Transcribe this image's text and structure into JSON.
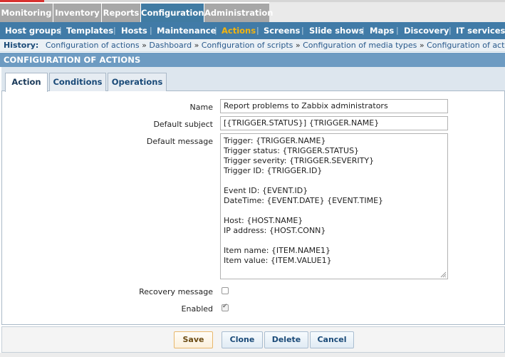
{
  "top_menu": [
    {
      "label": "Monitoring"
    },
    {
      "label": "Inventory"
    },
    {
      "label": "Reports"
    },
    {
      "label": "Configuration"
    },
    {
      "label": "Administration"
    }
  ],
  "sub_menu": [
    {
      "label": "Host groups"
    },
    {
      "label": "Templates"
    },
    {
      "label": "Hosts"
    },
    {
      "label": "Maintenance"
    },
    {
      "label": "Actions"
    },
    {
      "label": "Screens"
    },
    {
      "label": "Slide shows"
    },
    {
      "label": "Maps"
    },
    {
      "label": "Discovery"
    },
    {
      "label": "IT services"
    }
  ],
  "sub_menu_separator": "|",
  "history": {
    "label": "History:",
    "separator": "»",
    "items": [
      "Configuration of actions",
      "Dashboard",
      "Configuration of scripts",
      "Configuration of media types",
      "Configuration of actions"
    ]
  },
  "page_title": "CONFIGURATION OF ACTIONS",
  "tabs": [
    {
      "label": "Action"
    },
    {
      "label": "Conditions"
    },
    {
      "label": "Operations"
    }
  ],
  "form": {
    "name_label": "Name",
    "name_value": "Report problems to Zabbix administrators",
    "subject_label": "Default subject",
    "subject_value": "[{TRIGGER.STATUS}] {TRIGGER.NAME}",
    "message_label": "Default message",
    "message_lines": [
      "Trigger: {TRIGGER.NAME}",
      "Trigger status: {TRIGGER.STATUS}",
      "Trigger severity: {TRIGGER.SEVERITY}",
      "Trigger ID: {TRIGGER.ID}",
      "",
      "Event ID: {EVENT.ID}",
      "DateTime: {EVENT.DATE} {EVENT.TIME}",
      "",
      "Host: {HOST.NAME}",
      "IP address: {HOST.CONN}",
      "",
      "Item name: {ITEM.NAME1}",
      "Item value: {ITEM.VALUE1}"
    ],
    "recovery_label": "Recovery message",
    "recovery_checked": false,
    "enabled_label": "Enabled",
    "enabled_checked": true
  },
  "buttons": {
    "save": "Save",
    "clone": "Clone",
    "delete": "Delete",
    "cancel": "Cancel"
  },
  "colors": {
    "accent": "#417ba7",
    "active_submenu": "#f3b40f",
    "header": "#6d9bc2",
    "top_tab": "#a7a7a7"
  }
}
